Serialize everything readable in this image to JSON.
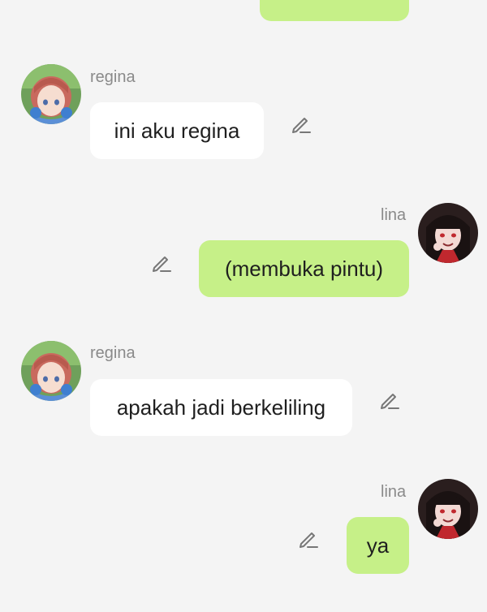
{
  "chat": {
    "messages": [
      {
        "id": 0,
        "side": "right",
        "text": ""
      },
      {
        "id": 1,
        "side": "left",
        "sender": "regina",
        "text": "ini aku regina"
      },
      {
        "id": 2,
        "side": "right",
        "sender": "lina",
        "text": "(membuka pintu)"
      },
      {
        "id": 3,
        "side": "left",
        "sender": "regina",
        "text": "apakah jadi berkeliling"
      },
      {
        "id": 4,
        "side": "right",
        "sender": "lina",
        "text": "ya"
      }
    ]
  },
  "icons": {
    "edit": "pencil-edit-icon",
    "avatar_regina": "avatar-regina",
    "avatar_lina": "avatar-lina"
  },
  "colors": {
    "background": "#f4f4f4",
    "bubble_left": "#ffffff",
    "bubble_right": "#c6f088",
    "sender_name": "#8a8a8a"
  }
}
